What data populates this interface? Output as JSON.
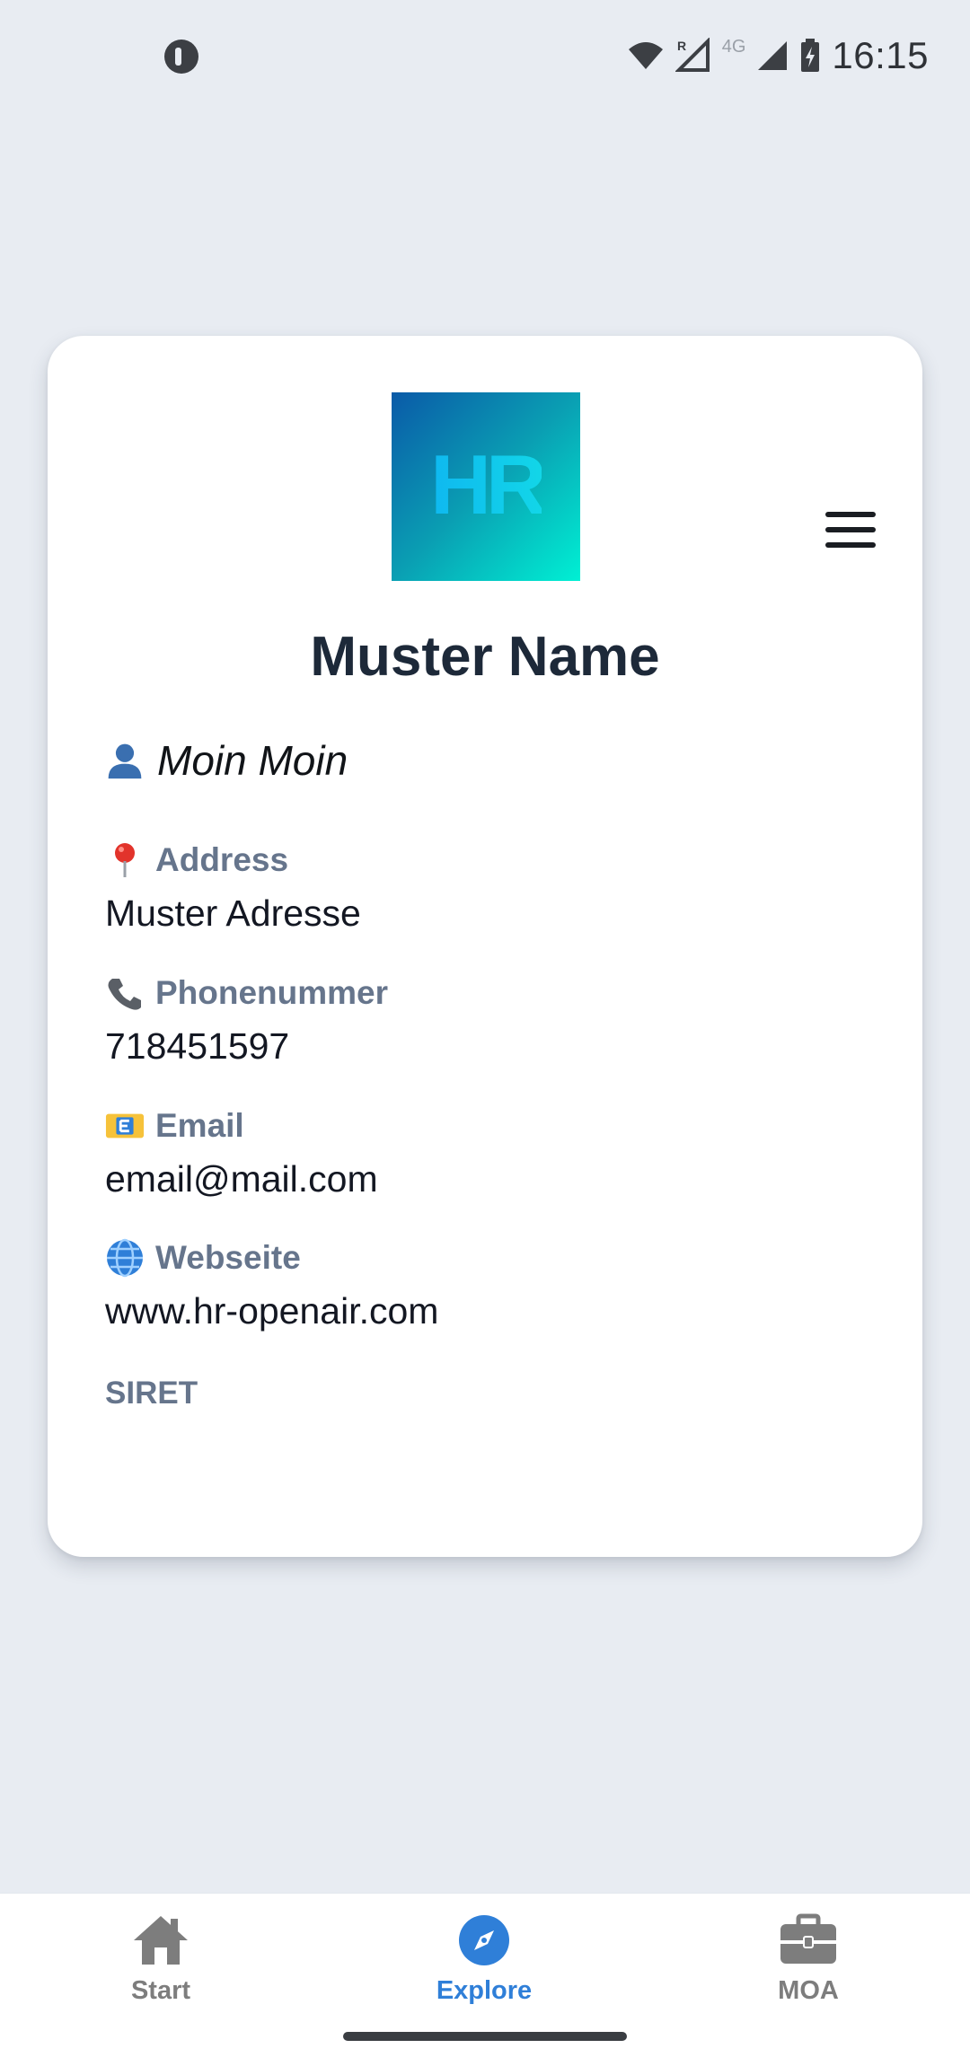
{
  "status_bar": {
    "time": "16:15",
    "network": "4G",
    "roaming": "R"
  },
  "card": {
    "logo_text": "HR",
    "title": "Muster Name",
    "greeting": "Moin Moin",
    "fields": [
      {
        "icon": "pin-icon",
        "label": "Address",
        "value": "Muster Adresse"
      },
      {
        "icon": "phone-icon",
        "label": "Phonenummer",
        "value": "718451597"
      },
      {
        "icon": "email-icon",
        "label": "Email",
        "value": "email@mail.com"
      },
      {
        "icon": "globe-icon",
        "label": "Webseite",
        "value": "www.hr-openair.com"
      }
    ],
    "siret_label": "SIRET"
  },
  "bottom_nav": {
    "items": [
      {
        "label": "Start",
        "icon": "home-icon",
        "active": false
      },
      {
        "label": "Explore",
        "icon": "compass-icon",
        "active": true
      },
      {
        "label": "MOA",
        "icon": "briefcase-icon",
        "active": false
      }
    ],
    "active_color": "#2f7fd8",
    "inactive_color": "#7d7d7d"
  }
}
